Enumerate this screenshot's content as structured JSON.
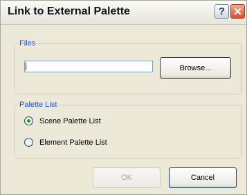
{
  "dialog": {
    "title": "Link to External Palette",
    "help_label": "?",
    "close_label": "✕"
  },
  "files_group": {
    "label": "Files",
    "path_value": "",
    "browse_label": "Browse..."
  },
  "palette_group": {
    "label": "Palette List",
    "options": [
      {
        "label": "Scene Palette List",
        "selected": true
      },
      {
        "label": "Element Palette List",
        "selected": false
      }
    ]
  },
  "footer": {
    "ok_label": "OK",
    "cancel_label": "Cancel",
    "ok_enabled": false
  },
  "colors": {
    "group_label": "#1f4fcf",
    "radio_selected": "#21a121",
    "close_button": "#d5532f"
  }
}
